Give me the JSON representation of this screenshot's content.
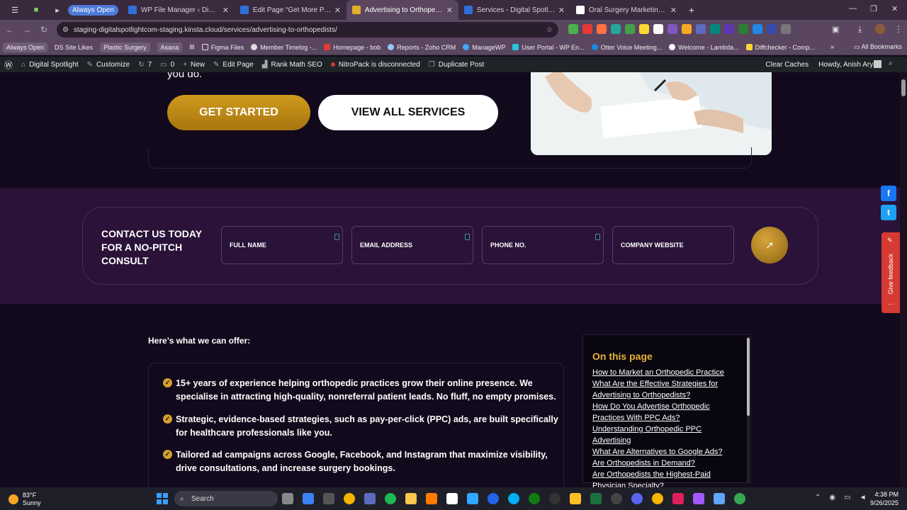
{
  "browser": {
    "always_open_badge": "Always Open",
    "tabs": [
      {
        "title": "WP File Manager ‹ Digital Spotli",
        "color": "#2f6fdb"
      },
      {
        "title": "Edit Page “Get More Patients O",
        "color": "#2f6fdb"
      },
      {
        "title": "Advertising to Orthopedists, PP",
        "color": "#e0b22c"
      },
      {
        "title": "Services - Digital Spotlight — W",
        "color": "#2f6fdb"
      },
      {
        "title": "Oral Surgery Marketing Agency",
        "color": "#ffffff"
      }
    ],
    "new_tab": "+",
    "url": "staging-digitalspotlightcom-staging.kinsta.cloud/services/advertising-to-orthopedists/",
    "bookmarks": [
      {
        "label": "Always Open",
        "pill": true
      },
      {
        "label": "DS Site Likes",
        "pill": false
      },
      {
        "label": "Plastic Surgery",
        "pill": true
      },
      {
        "label": "Asana",
        "pill": true
      },
      {
        "label": "Figma Files",
        "pill": false
      },
      {
        "label": "Member Timelog -...",
        "pill": false
      },
      {
        "label": "Homepage - bob",
        "pill": false
      },
      {
        "label": "Reports - Zoho CRM",
        "pill": false
      },
      {
        "label": "ManageWP",
        "pill": false
      },
      {
        "label": "User Portal - WP En...",
        "pill": false
      },
      {
        "label": "Otter Voice Meeting...",
        "pill": false
      },
      {
        "label": "Welcome - Lambda...",
        "pill": false
      },
      {
        "label": "Diffchecker - Comp...",
        "pill": false
      }
    ],
    "all_bookmarks": "All Bookmarks"
  },
  "adminbar": {
    "site": "Digital Spotlight",
    "customize": "Customize",
    "updates": "7",
    "comments": "0",
    "new": "New",
    "edit_page": "Edit Page",
    "rank_math": "Rank Math SEO",
    "nitropack": "NitroPack is disconnected",
    "duplicate": "Duplicate Post",
    "clear_caches": "Clear Caches",
    "howdy": "Howdy, Anish Aryal"
  },
  "hero": {
    "text_tail": "you do.",
    "get_started": "GET STARTED",
    "view_all": "VIEW ALL SERVICES"
  },
  "contact": {
    "title": "CONTACT US TODAY FOR A NO-PITCH CONSULT",
    "fields": {
      "full_name": "FULL NAME",
      "email": "EMAIL ADDRESS",
      "phone": "PHONE NO.",
      "website": "COMPANY WEBSITE"
    },
    "submit_glyph": "↗"
  },
  "offer": {
    "heading": "Here’s what we can offer:",
    "items": [
      "15+ years of experience helping orthopedic practices grow their online presence. We specialise in attracting high-quality, nonreferral patient leads. No fluff, no empty promises.",
      "Strategic, evidence-based strategies, such as pay-per-click (PPC) ads, are built specifically for healthcare professionals like you.",
      "Tailored ad campaigns across Google, Facebook, and Instagram that maximize visibility, drive consultations, and increase surgery bookings."
    ]
  },
  "toc": {
    "title": "On this page",
    "links": [
      "How to Market an Orthopedic Practice",
      "What Are the Effective Strategies for Advertising to Orthopedists?",
      "How Do You Advertise Orthopedic Practices With PPC Ads?",
      "Understanding Orthopedic PPC Advertising",
      "What Are Alternatives to Google Ads?",
      "Are Orthopedists in Demand?",
      "Are Orthopedists the Highest-Paid Physician Specialty?"
    ]
  },
  "feedback": {
    "label": "Give feedback"
  },
  "taskbar": {
    "temp": "83°F",
    "condition": "Sunny",
    "search": "Search",
    "time": "4:38 PM",
    "date": "9/26/2025"
  },
  "colors": {
    "accent_gold": "#d2a12c",
    "page_bg": "#120a1c",
    "band_bg": "#2a1238"
  }
}
